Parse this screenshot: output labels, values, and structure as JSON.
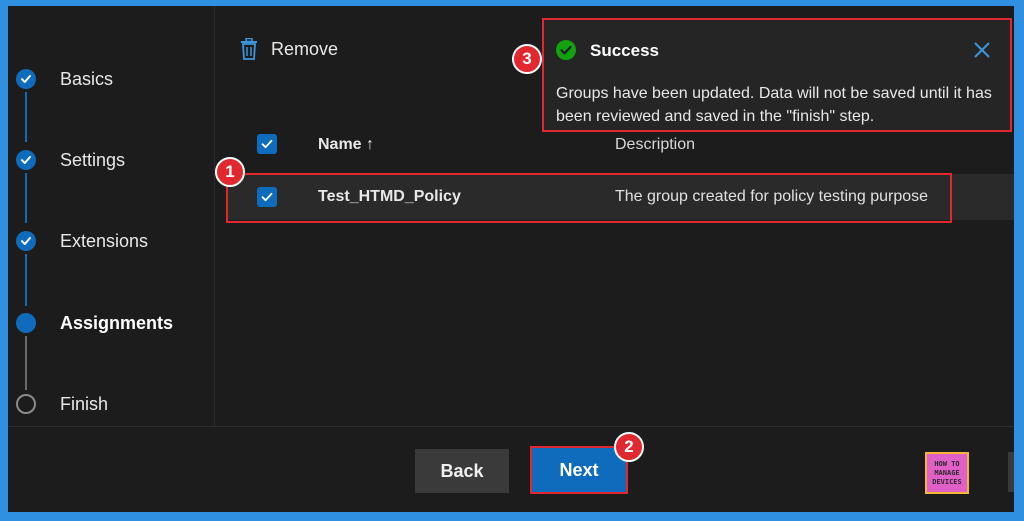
{
  "steps": [
    {
      "label": "Basics",
      "state": "done"
    },
    {
      "label": "Settings",
      "state": "done"
    },
    {
      "label": "Extensions",
      "state": "done"
    },
    {
      "label": "Assignments",
      "state": "current"
    },
    {
      "label": "Finish",
      "state": "pending"
    }
  ],
  "toolbar": {
    "remove_label": "Remove"
  },
  "table": {
    "columns": {
      "name": "Name ↑",
      "description": "Description"
    },
    "rows": [
      {
        "name": "Test_HTMD_Policy",
        "description": "The group created for policy testing purpose"
      }
    ]
  },
  "toast": {
    "title": "Success",
    "message": "Groups have been updated. Data will not be saved until it has been reviewed and saved in the \"finish\" step."
  },
  "annotations": {
    "one": "1",
    "two": "2",
    "three": "3"
  },
  "footer": {
    "back_label": "Back",
    "next_label": "Next"
  },
  "logo": {
    "line1": "HOW TO",
    "line2": "MANAGE",
    "line3": "DEVICES"
  },
  "colors": {
    "accent": "#0f6cbd",
    "highlight": "#e0282e",
    "success": "#13a10e",
    "background": "#1c1c1c"
  },
  "icons": {
    "remove": "trash-icon",
    "success": "check-circle-icon",
    "close": "close-icon",
    "step_done": "check-icon"
  }
}
